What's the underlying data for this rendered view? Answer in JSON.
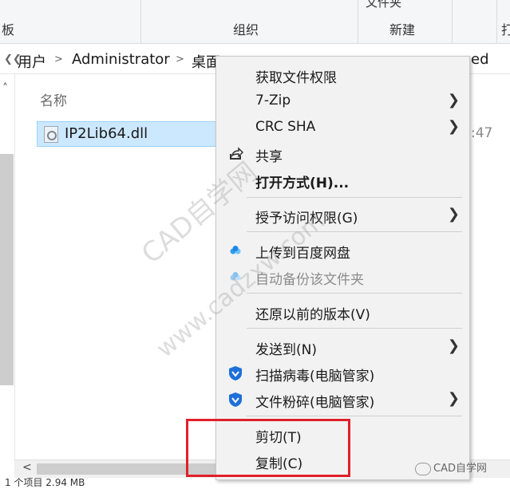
{
  "ribbon": {
    "left_cut_label": "板",
    "organize_label": "组织",
    "new_label": "新建",
    "top_partial": "文件夹",
    "right_cut_label": "打"
  },
  "address": {
    "crumbs": [
      "用户",
      "Administrator",
      "桌面"
    ],
    "trailing_text": "ed"
  },
  "content": {
    "column_name": "名称",
    "file_name": "IP2Lib64.dll",
    "time_fragment": ":47"
  },
  "status": {
    "text": "1 个项目   2.94 MB"
  },
  "context_menu": {
    "items": [
      {
        "label": "获取文件权限"
      },
      {
        "label": "7-Zip"
      },
      {
        "label": "CRC SHA"
      },
      {
        "label": "共享"
      },
      {
        "label": "打开方式(H)..."
      },
      {
        "label": "授予访问权限(G)"
      },
      {
        "label": "上传到百度网盘"
      },
      {
        "label": "自动备份该文件夹"
      },
      {
        "label": "还原以前的版本(V)"
      },
      {
        "label": "发送到(N)"
      },
      {
        "label": "扫描病毒(电脑管家)"
      },
      {
        "label": "文件粉碎(电脑管家)"
      },
      {
        "label": "剪切(T)"
      },
      {
        "label": "复制(C)"
      }
    ]
  },
  "watermark": {
    "text1": "CAD自学网",
    "text2": "www.cadzxw.com",
    "logo_text": "CAD自学网"
  },
  "colors": {
    "selection_bg": "#cce8ff",
    "highlight_box": "#e0202a",
    "menu_bg": "#f2f2f2",
    "shield_blue": "#1e6fd9",
    "baidu_cloud": "#2d9bf0"
  },
  "icons": {
    "share": "share-icon",
    "baidu": "baidu-cloud-icon",
    "tencent": "tencent-shield-icon",
    "submenu": "chevron-right-icon"
  }
}
